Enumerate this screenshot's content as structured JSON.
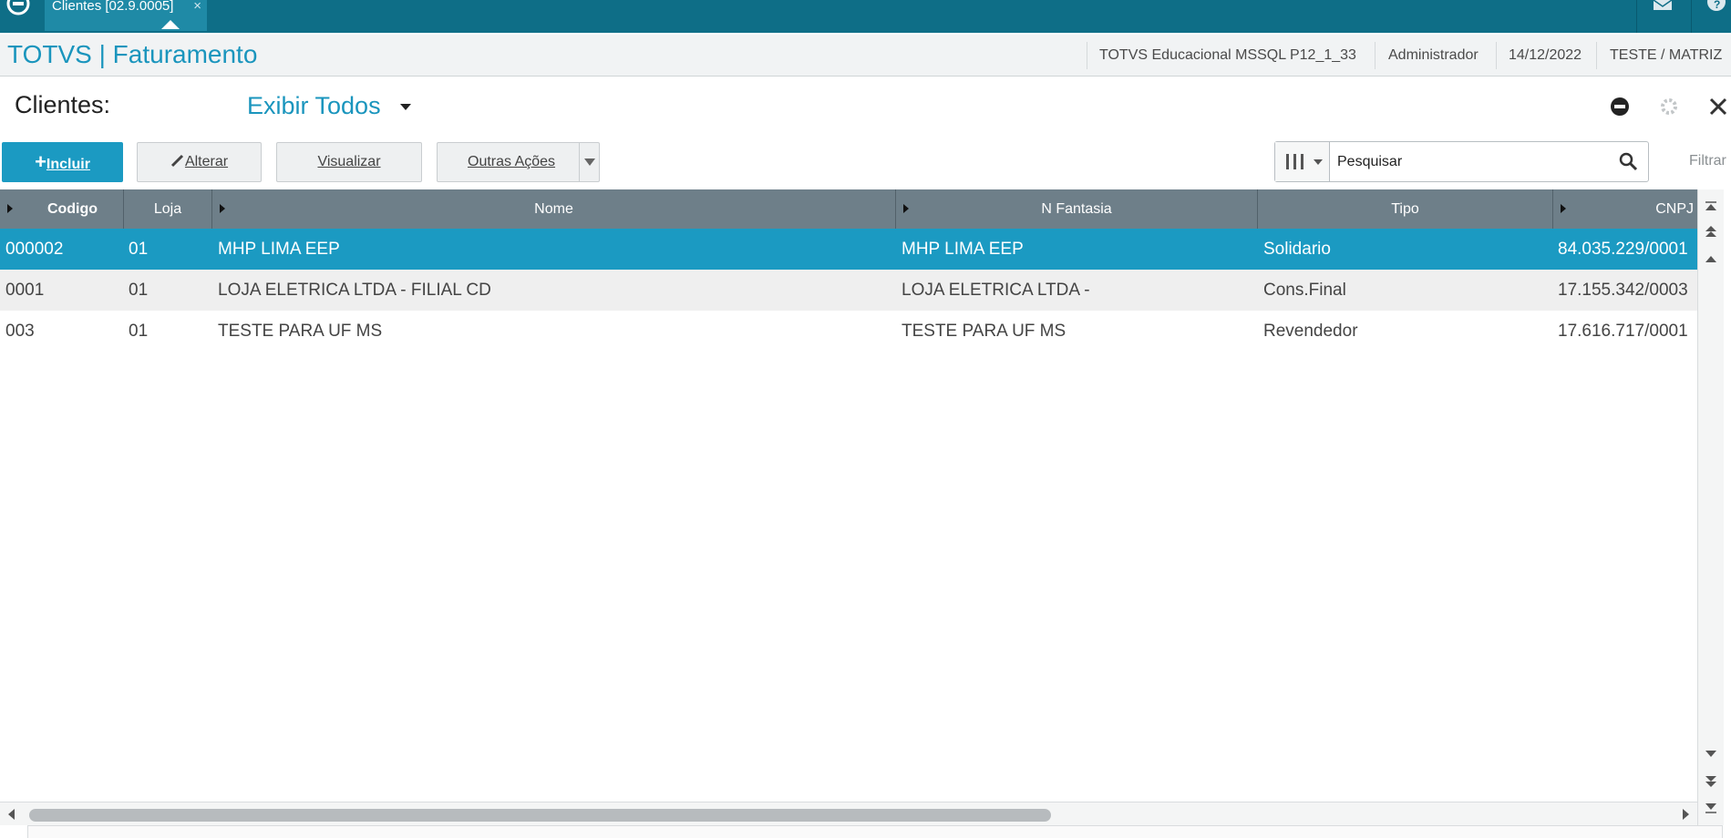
{
  "topbar": {
    "tab_label": "Clientes [02.9.0005]",
    "tab_close": "×",
    "bg_color": "#0e6e87"
  },
  "header": {
    "app_title": "TOTVS | Faturamento",
    "environment": "TOTVS Educacional MSSQL P12_1_33",
    "user": "Administrador",
    "date": "14/12/2022",
    "company": "TESTE / MATRIZ"
  },
  "browse": {
    "title": "Clientes:",
    "view_filter": "Exibir Todos"
  },
  "toolbar": {
    "incluir_prefix": "+",
    "incluir_label": "Incluir",
    "alterar_label": "Alterar",
    "visualizar_label": "Visualizar",
    "outras_label": "Outras Ações"
  },
  "search": {
    "placeholder": "Pesquisar",
    "filter_label": "Filtrar"
  },
  "grid": {
    "columns": [
      "Codigo",
      "Loja",
      "Nome",
      "N Fantasia",
      "Tipo",
      "CNPJ"
    ],
    "rows": [
      [
        "000002",
        "01",
        "MHP LIMA EEP",
        "MHP LIMA EEP",
        "Solidario",
        "84.035.229/0001"
      ],
      [
        "0001",
        "01",
        "LOJA ELETRICA LTDA - FILIAL CD",
        "LOJA ELETRICA LTDA -",
        "Cons.Final",
        "17.155.342/0003"
      ],
      [
        "003",
        "01",
        "TESTE PARA UF MS",
        "TESTE PARA UF MS",
        "Revendedor",
        "17.616.717/0001"
      ]
    ],
    "selected_row": 0,
    "selected_color": "#1b9ac2"
  },
  "icons": {
    "logo": "totvs-logo-icon",
    "mail": "mail-icon",
    "help": "help-icon",
    "minimize": "minimize-icon",
    "settings": "gear-icon",
    "close": "close-icon",
    "search": "search-icon",
    "columns": "columns-icon"
  }
}
